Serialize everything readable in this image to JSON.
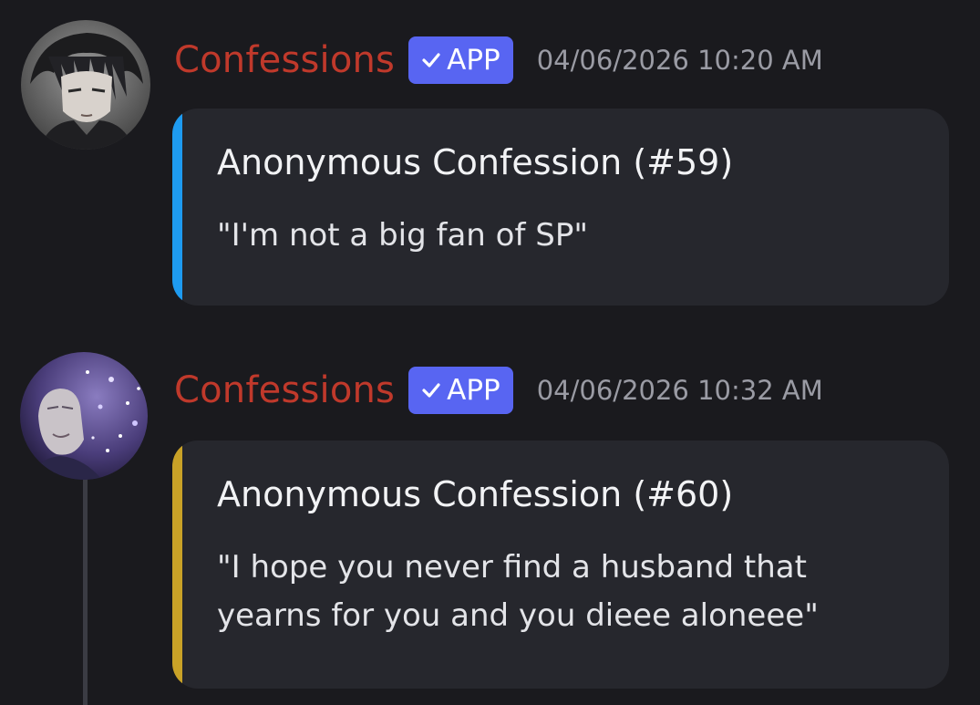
{
  "messages": [
    {
      "username": "Confessions",
      "badge_label": "APP",
      "badge_icon": "checkmark-icon",
      "timestamp": "04/06/2026 10:20 AM",
      "embed": {
        "accent_color": "#1e9bf0",
        "title": "Anonymous Confession (#59)",
        "description": "\"I'm not a big fan of SP\""
      }
    },
    {
      "username": "Confessions",
      "badge_label": "APP",
      "badge_icon": "checkmark-icon",
      "timestamp": "04/06/2026 10:32 AM",
      "embed": {
        "accent_color": "#c9a227",
        "title": "Anonymous Confession (#60)",
        "description": "\"I hope you never find a husband that yearns for you and you dieee aloneee\""
      }
    }
  ],
  "colors": {
    "background": "#1a1a1e",
    "embed_background": "#26272d",
    "username": "#c0392b",
    "badge": "#5865f2",
    "timestamp": "#9a9ba4"
  }
}
